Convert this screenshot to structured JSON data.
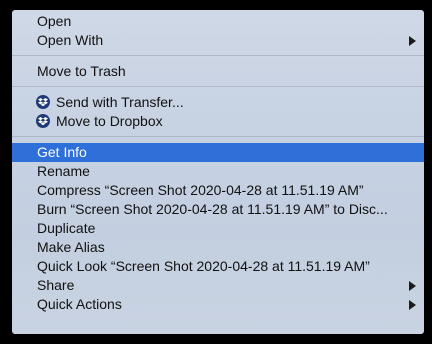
{
  "menu": {
    "group1": {
      "open": "Open",
      "open_with": "Open With"
    },
    "group2": {
      "move_to_trash": "Move to Trash"
    },
    "group3": {
      "send_with_transfer": "Send with Transfer...",
      "move_to_dropbox": "Move to Dropbox",
      "icon": "dropbox-icon"
    },
    "group4": {
      "get_info": "Get Info",
      "rename": "Rename",
      "compress": "Compress “Screen Shot 2020-04-28 at 11.51.19 AM”",
      "burn": "Burn “Screen Shot 2020-04-28 at 11.51.19 AM” to Disc...",
      "duplicate": "Duplicate",
      "make_alias": "Make Alias",
      "quick_look": "Quick Look “Screen Shot 2020-04-28 at 11.51.19 AM”",
      "share": "Share",
      "quick_actions": "Quick Actions"
    },
    "selected_item": "Get Info",
    "colors": {
      "highlight": "#2f6fd8",
      "dropbox_icon": "#1e3a76"
    }
  }
}
